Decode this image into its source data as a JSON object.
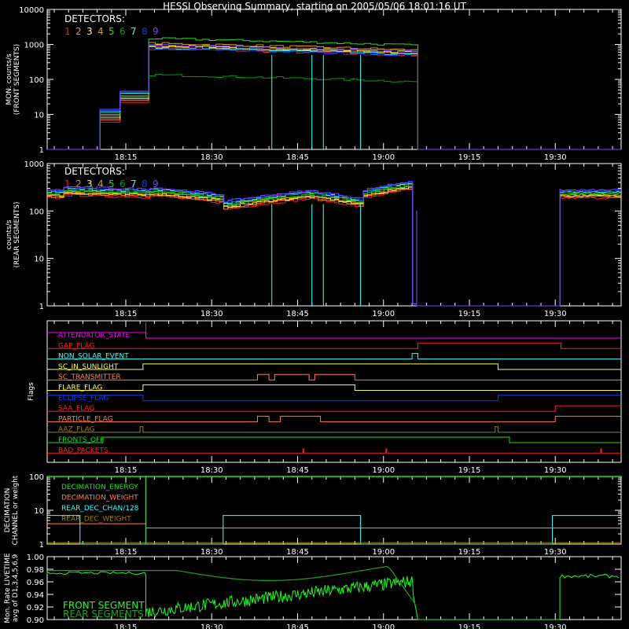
{
  "title": "HESSI Observing Summary, starting on 2005/05/06 18:01:16 UT",
  "time_ticks": [
    "18:15",
    "18:30",
    "18:45",
    "19:00",
    "19:15",
    "19:30"
  ],
  "detector_colors": [
    "#ff2020",
    "#ff8040",
    "#ffff40",
    "#e0a000",
    "#20e020",
    "#00a000",
    "#40ffff",
    "#0040ff",
    "#8040ff"
  ],
  "chart_data": [
    {
      "type": "line",
      "title": "",
      "ylabel": "MON. counts/s\n(FRONT SEGMENTS)",
      "ylog": true,
      "ylim": [
        1,
        10000
      ],
      "y_ticks": [
        "1",
        "10",
        "100",
        "1000",
        "10000"
      ],
      "legend_title": "DETECTORS:",
      "legend": [
        "1",
        "2",
        "3",
        "4",
        "5",
        "6",
        "7",
        "8",
        "9"
      ]
    },
    {
      "type": "line",
      "title": "",
      "ylabel": "counts/s\n(REAR SEGMENTS)",
      "ylog": true,
      "ylim": [
        1,
        1000
      ],
      "y_ticks": [
        "1",
        "10",
        "100",
        "1000"
      ],
      "legend_title": "DETECTORS:",
      "legend": [
        "1",
        "2",
        "3",
        "4",
        "5",
        "6",
        "7",
        "8",
        "9"
      ]
    },
    {
      "type": "line",
      "ylabel": "Flags",
      "flags": [
        {
          "name": "ATTENUATOR_STATE",
          "color": "#ff00ff"
        },
        {
          "name": "GAP_FLAG",
          "color": "#ff2020"
        },
        {
          "name": "NON_SOLAR_EVENT",
          "color": "#40ffff"
        },
        {
          "name": "SC_IN_SUNLIGHT",
          "color": "#ffff40"
        },
        {
          "name": "SC_TRANSMITTER",
          "color": "#ff8040"
        },
        {
          "name": "FLARE_FLAG",
          "color": "#ffff40"
        },
        {
          "name": "ECLIPSE_FLAG",
          "color": "#0040ff"
        },
        {
          "name": "SAA_FLAG",
          "color": "#ff2020"
        },
        {
          "name": "PARTICLE_FLAG",
          "color": "#ff8040"
        },
        {
          "name": "AAZ_FLAG",
          "color": "#a08000"
        },
        {
          "name": "FRONTS_OFF",
          "color": "#20e020"
        },
        {
          "name": "BAD_PACKETS",
          "color": "#ff2020"
        }
      ]
    },
    {
      "type": "line",
      "ylabel": "DECIMATION\nCHANNEL or weight",
      "ylog": true,
      "ylim": [
        1,
        100
      ],
      "y_ticks": [
        "1",
        "10",
        "100"
      ],
      "legend": [
        {
          "name": "DECIMATION_ENERGY",
          "color": "#20e020"
        },
        {
          "name": "DECIMATION_WEIGHT",
          "color": "#ff8040"
        },
        {
          "name": "REAR_DEC_CHAN/128",
          "color": "#40ffff"
        },
        {
          "name": "REAR_DEC_WEIGHT",
          "color": "#a08000"
        }
      ]
    },
    {
      "type": "line",
      "ylabel": "Mon. Rate LIVETIME\navg of D1,3,4,5,6,9",
      "ylim": [
        0.9,
        1.0
      ],
      "y_ticks": [
        "0.90",
        "0.92",
        "0.94",
        "0.96",
        "0.98",
        "1.00"
      ],
      "legend": [
        {
          "name": "FRONT SEGMENT",
          "color": "#20ff20"
        },
        {
          "name": "REAR SEGMENTS",
          "color": "#20a020"
        }
      ]
    }
  ]
}
